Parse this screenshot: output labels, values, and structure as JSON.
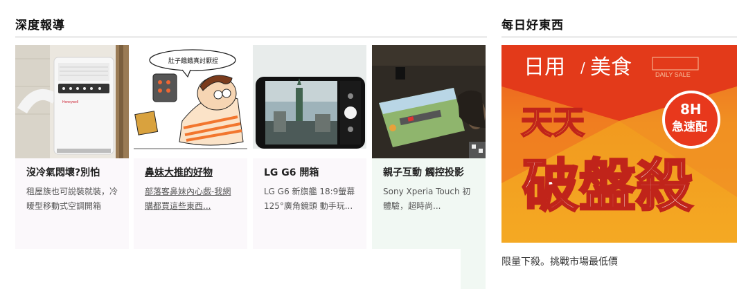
{
  "left_section": {
    "title": "深度報導",
    "cards": [
      {
        "title": "沒冷氣悶壞?別怕",
        "desc": "租屋族也可說裝就裝，冷暖型移動式空調開箱",
        "brand": "Honeywell"
      },
      {
        "title": "鼻妹大推的好物",
        "desc": "部落客鼻妹內心戲-我網購都買這些東西...",
        "speech": "肚子餓餓真討厭捏"
      },
      {
        "title": "LG G6 開箱",
        "desc": "LG G6 新旗艦 18:9螢幕 125°廣角鏡頭 動手玩..."
      },
      {
        "title": "親子互動 觸控投影",
        "desc": "Sony Xperia Touch 初體驗，超時尚..."
      }
    ]
  },
  "right_section": {
    "title": "每日好東西",
    "promo": {
      "header_left": "日用",
      "header_sep": "/",
      "header_right": "美食",
      "daily_sale": "DAILY SALE",
      "badge_line1": "8H",
      "badge_line2": "急速配",
      "headline_top": "天天",
      "headline_main": "破盤殺",
      "caption": "限量下殺。挑戰市場最低價"
    }
  },
  "colors": {
    "promo_orange": "#f29a1f",
    "promo_red": "#e8381c",
    "card_bg_1": "#fbf8fb",
    "card_bg_4": "#f1f8f3"
  }
}
